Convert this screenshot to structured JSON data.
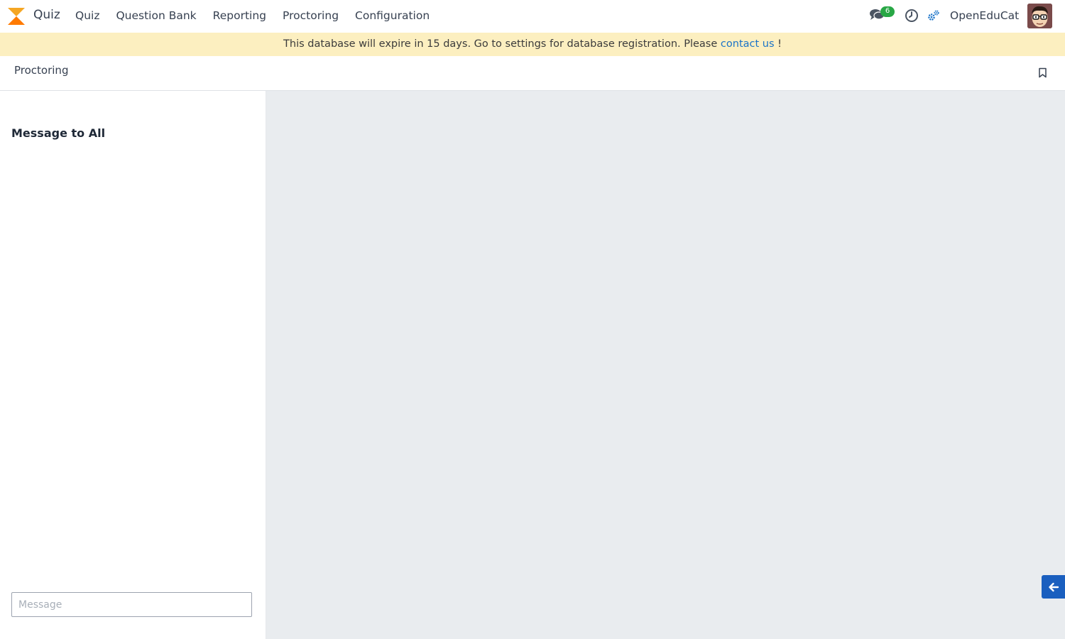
{
  "app": {
    "name": "Quiz",
    "brand_color": "#f59e0b"
  },
  "menu": {
    "items": [
      "Quiz",
      "Question Bank",
      "Reporting",
      "Proctoring",
      "Configuration"
    ]
  },
  "systray": {
    "messages_count": "6",
    "company": "OpenEduCat",
    "icons": [
      "chat-icon",
      "clock-icon",
      "gear-icon"
    ]
  },
  "banner": {
    "text": "This database will expire in 15 days. Go to settings for database registration. Please ",
    "link_text": "contact us",
    "suffix": " !",
    "background": "#fcefc0",
    "link_color": "#1a73c8"
  },
  "breadcrumb": {
    "current": "Proctoring"
  },
  "left_panel": {
    "title": "Message to All",
    "input_placeholder": "Message"
  },
  "colors": {
    "main_background": "#e9ecef",
    "toggle_button": "#1a5fbf",
    "badge": "#28a745"
  }
}
